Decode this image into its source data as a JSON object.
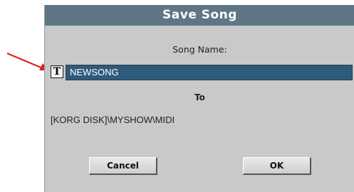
{
  "dialog": {
    "title": "Save Song",
    "song_name_label": "Song Name:",
    "text_edit_button": "T",
    "song_name_value": "NEWSONG",
    "to_label": "To",
    "destination_path": "[KORG DISK]\\MYSHOW\\MIDI",
    "cancel_label": "Cancel",
    "ok_label": "OK"
  },
  "colors": {
    "title_bar": "#5f7784",
    "dialog_bg": "#c9c9c9",
    "field_bg": "#2f5a7a",
    "annotation_arrow": "#e02020"
  },
  "icons": {
    "annotation": "red-arrow-icon",
    "text_edit": "text-edit-icon"
  }
}
